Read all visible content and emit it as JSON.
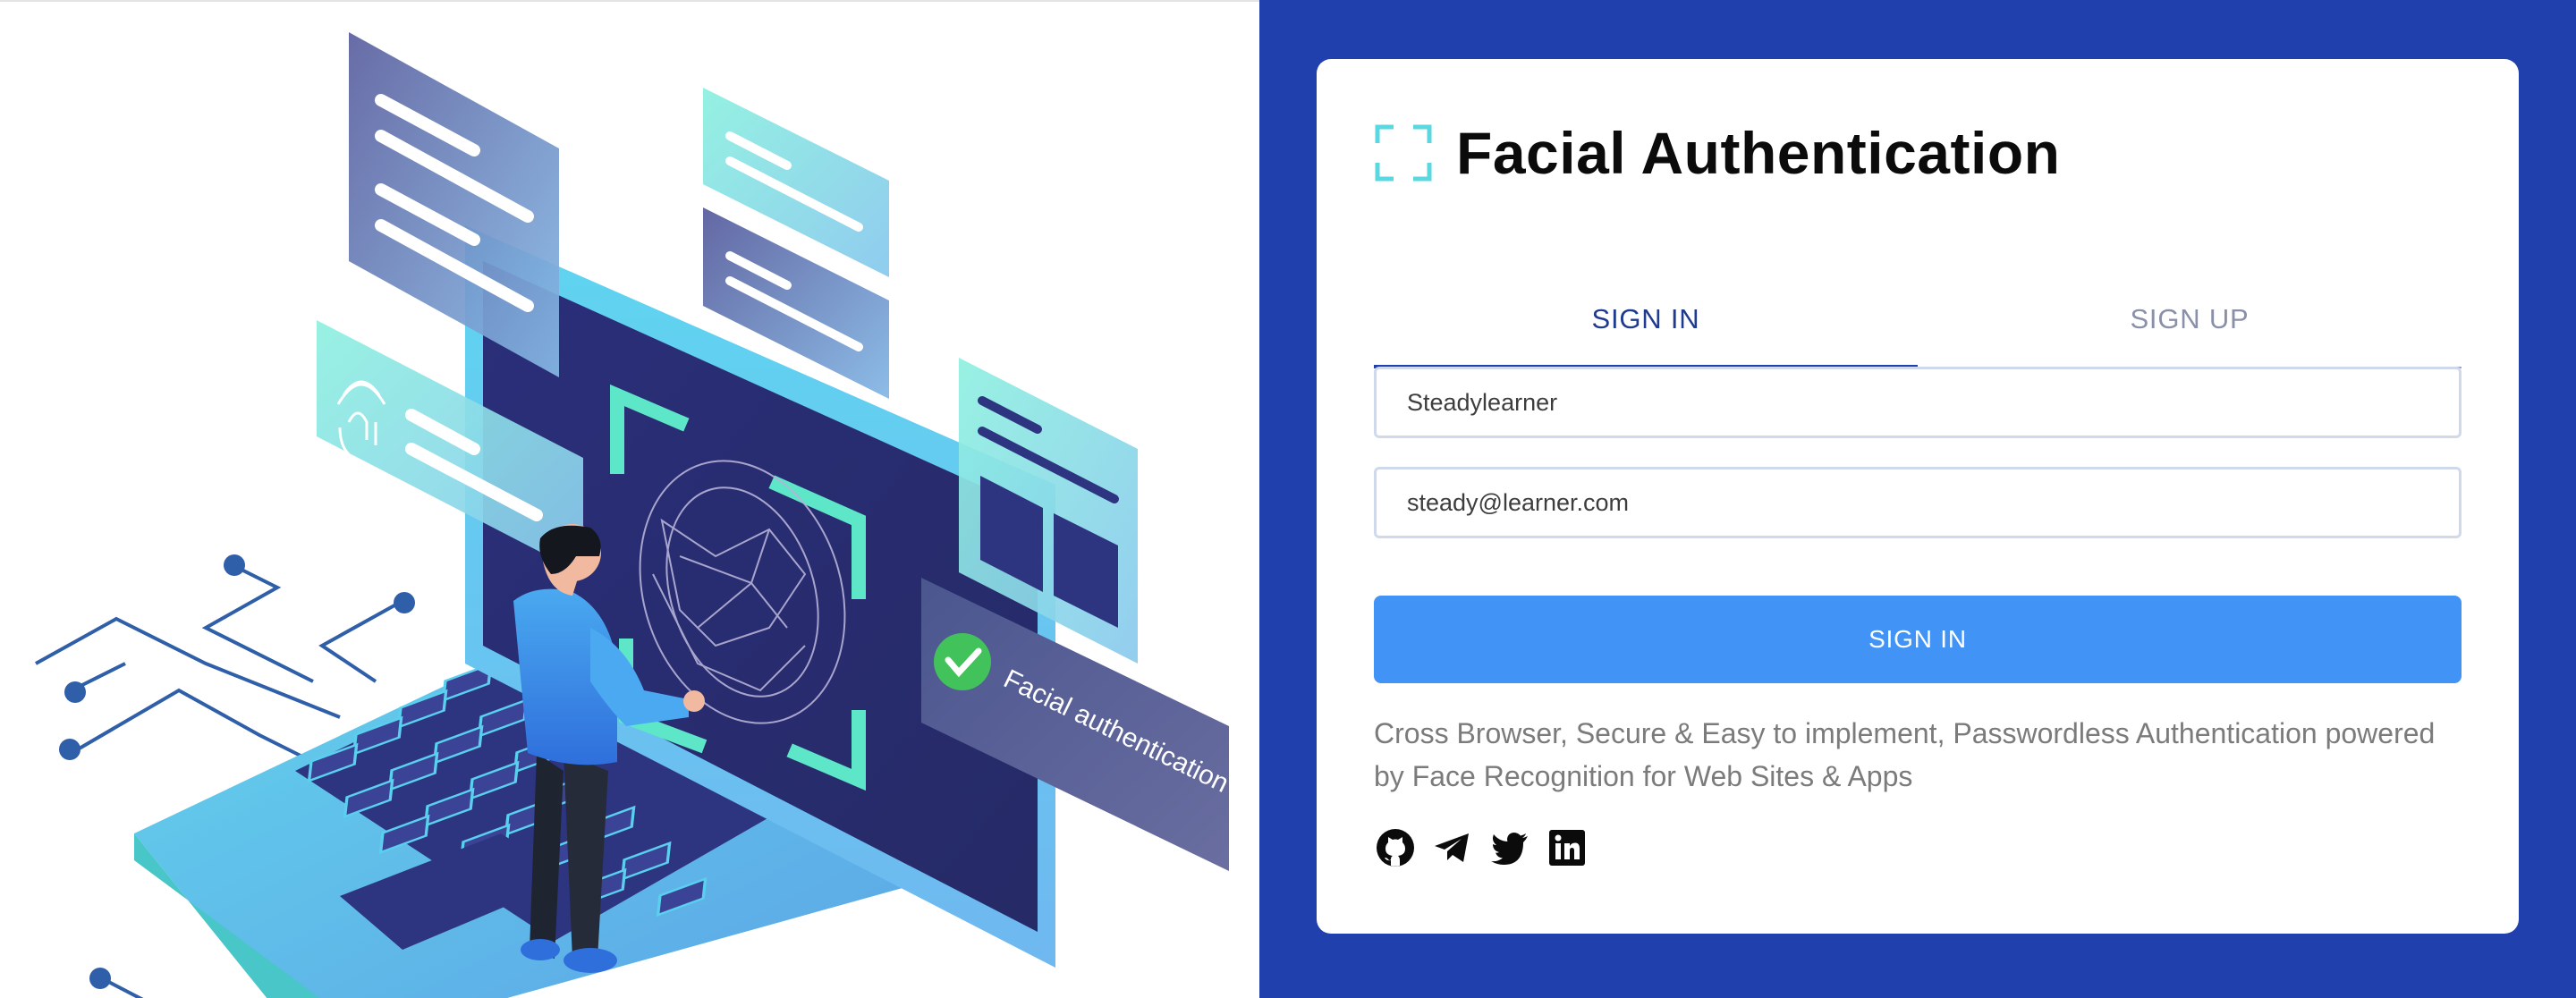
{
  "illustration": {
    "badge_text": "Facial authentication success",
    "icons": [
      "fingerprint-icon",
      "checkmark-icon"
    ]
  },
  "login": {
    "title": "Facial Authentication",
    "tabs": [
      {
        "label": "SIGN IN",
        "active": true
      },
      {
        "label": "SIGN UP",
        "active": false
      }
    ],
    "fields": {
      "username_value": "Steadylearner",
      "email_value": "steady@learner.com"
    },
    "submit_label": "SIGN IN",
    "description": "Cross Browser, Secure & Easy to implement, Passwordless Authentication powered by Face Recognition for Web Sites & Apps",
    "social": [
      "github-icon",
      "telegram-icon",
      "twitter-icon",
      "linkedin-icon"
    ]
  },
  "colors": {
    "panel_bg": "#1f40ad",
    "button": "#4194f5",
    "accent_teal": "#5ad8e0"
  }
}
